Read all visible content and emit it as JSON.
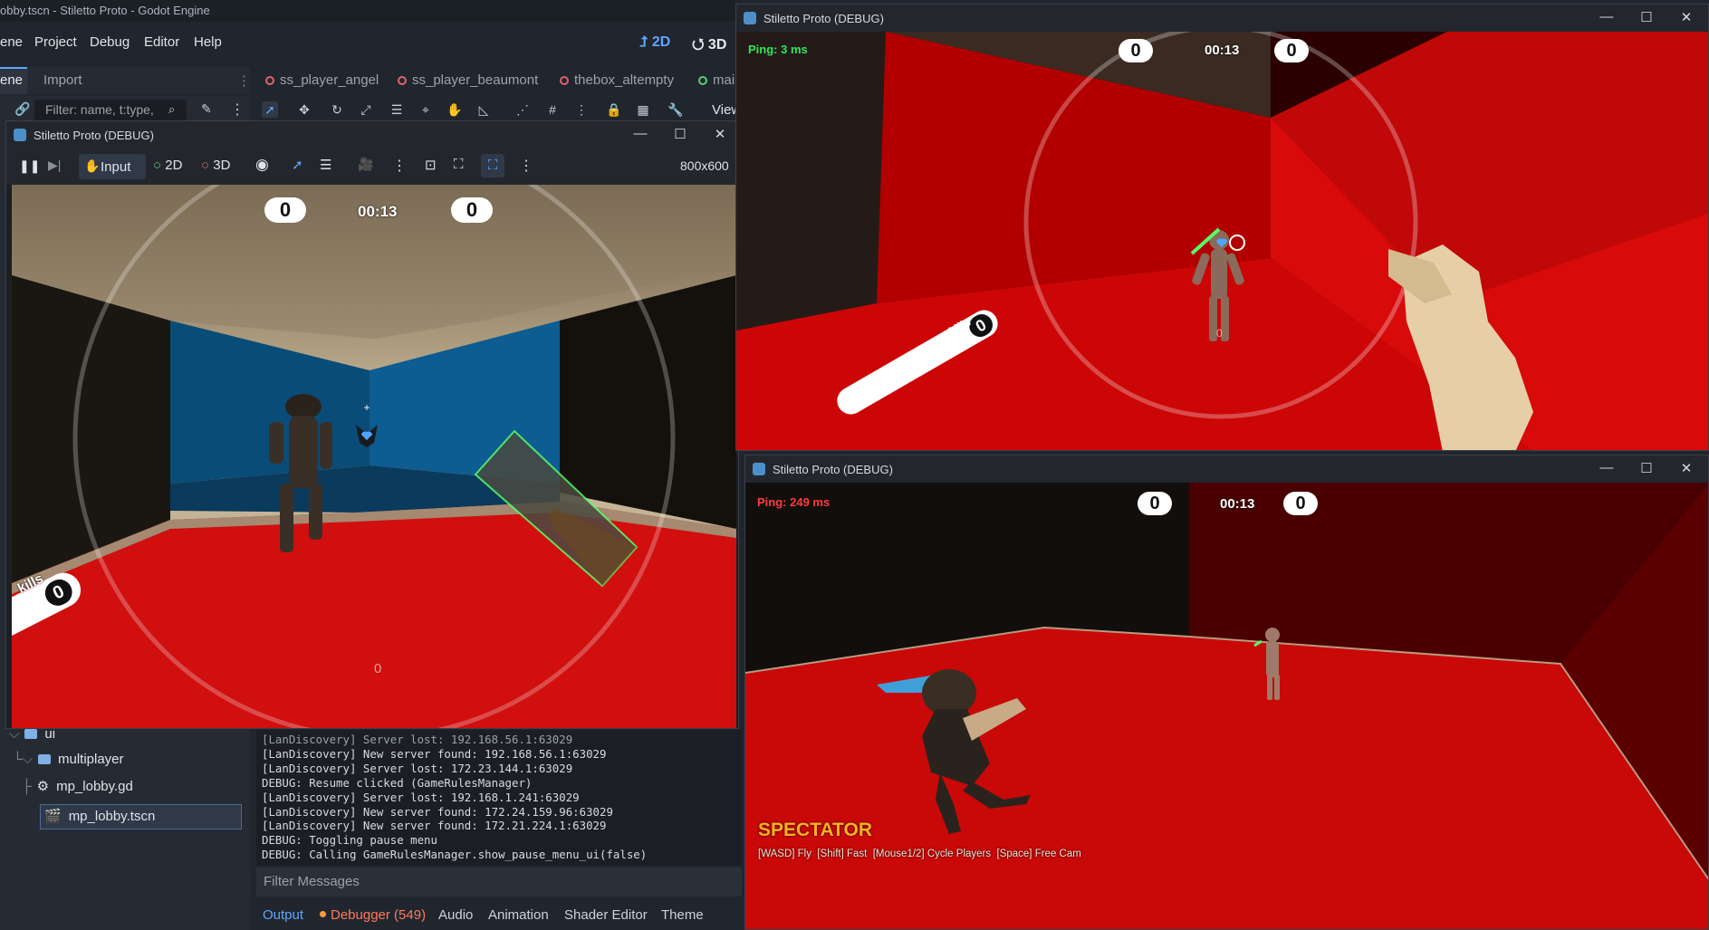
{
  "editor": {
    "title": "obby.tscn - Stiletto Proto - Godot Engine",
    "menu": [
      "ene",
      "Project",
      "Debug",
      "Editor",
      "Help"
    ],
    "mode_2d": "2D",
    "mode_3d": "3D",
    "dock_tabs": [
      "ene",
      "Import"
    ],
    "filter_placeholder": "Filter: name, t:type,",
    "scene_tabs": [
      "ss_player_angel",
      "ss_player_beaumont",
      "thebox_altempty",
      "mai"
    ],
    "view_label": "View",
    "tree": [
      {
        "label": "ui",
        "type": "folder"
      },
      {
        "label": "multiplayer",
        "type": "folder"
      },
      {
        "label": "mp_lobby.gd",
        "type": "script"
      },
      {
        "label": "mp_lobby.tscn",
        "type": "scene",
        "selected": true
      }
    ],
    "output_lines": [
      "[LanDiscovery] Server lost: 192.168.56.1:63029",
      "[LanDiscovery] New server found: 192.168.56.1:63029",
      "[LanDiscovery] Server lost: 172.23.144.1:63029",
      "DEBUG: Resume clicked (GameRulesManager)",
      "[LanDiscovery] Server lost: 192.168.1.241:63029",
      "[LanDiscovery] New server found: 172.24.159.96:63029",
      "[LanDiscovery] New server found: 172.21.224.1:63029",
      "DEBUG: Toggling pause menu",
      "DEBUG: Calling GameRulesManager.show_pause_menu_ui(false)"
    ],
    "filter_messages": "Filter Messages",
    "bottom_tabs": [
      "Output",
      "Debugger (549)",
      "Audio",
      "Animation",
      "Shader Editor",
      "Theme"
    ]
  },
  "win_main": {
    "title": "Stiletto Proto (DEBUG)",
    "toolbar": {
      "input": "Input",
      "mode_2d": "2D",
      "mode_3d": "3D",
      "resolution": "800x600"
    },
    "hud": {
      "score_left": "0",
      "time": "00:13",
      "score_right": "0",
      "kills": "kills",
      "kills_count": "0",
      "center_count": "0"
    }
  },
  "win_right_top": {
    "title": "Stiletto Proto (DEBUG)",
    "hud": {
      "ping": "Ping: 3 ms",
      "score_left": "0",
      "time": "00:13",
      "score_right": "0",
      "kills": "kills",
      "kills_count": "0",
      "center_count": "0"
    }
  },
  "win_right_bottom": {
    "title": "Stiletto Proto (DEBUG)",
    "hud": {
      "ping": "Ping: 249 ms",
      "score_left": "0",
      "time": "00:13",
      "score_right": "0",
      "spectator": "SPECTATOR",
      "spectator_help": "[WASD] Fly  [Shift] Fast  [Mouse1/2] Cycle Players  [Space] Free Cam"
    }
  },
  "colors": {
    "accent": "#5ea6ff",
    "ping_ok": "#2ee65a",
    "ping_bad": "#ff3b3b",
    "spectator": "#ffb020",
    "arena_red": "#cc0a0a"
  }
}
